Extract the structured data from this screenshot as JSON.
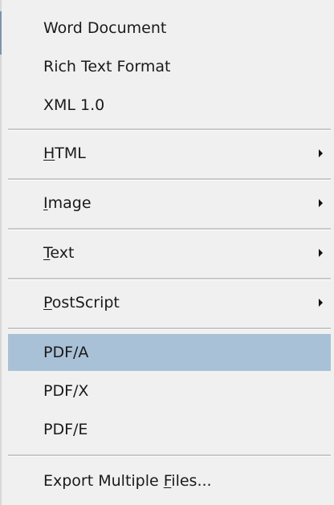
{
  "menu": {
    "items": [
      {
        "label": "Word Document"
      },
      {
        "label": "Rich Text Format"
      },
      {
        "label": "XML 1.0"
      },
      {
        "label": "HTML",
        "mnemonic": "H",
        "rest": "TML",
        "submenu": true
      },
      {
        "label": "Image",
        "mnemonic": "I",
        "rest": "mage",
        "submenu": true
      },
      {
        "label": "Text",
        "mnemonic": "T",
        "rest": "ext",
        "submenu": true
      },
      {
        "label": "PostScript",
        "mnemonic": "P",
        "rest": "ostScript",
        "submenu": true
      },
      {
        "label": "PDF/A",
        "selected": true
      },
      {
        "label": "PDF/X"
      },
      {
        "label": "PDF/E"
      },
      {
        "label": "Export Multiple Files...",
        "prefix": "Export Multiple ",
        "mnemonic": "F",
        "rest": "iles..."
      }
    ],
    "icons": {
      "submenu_arrow": "triangle-right-icon"
    },
    "colors": {
      "background": "#f0f0f0",
      "selected_background": "#a9c1d6",
      "separator": "#c9c9c9",
      "text": "#1a1a1a"
    }
  }
}
